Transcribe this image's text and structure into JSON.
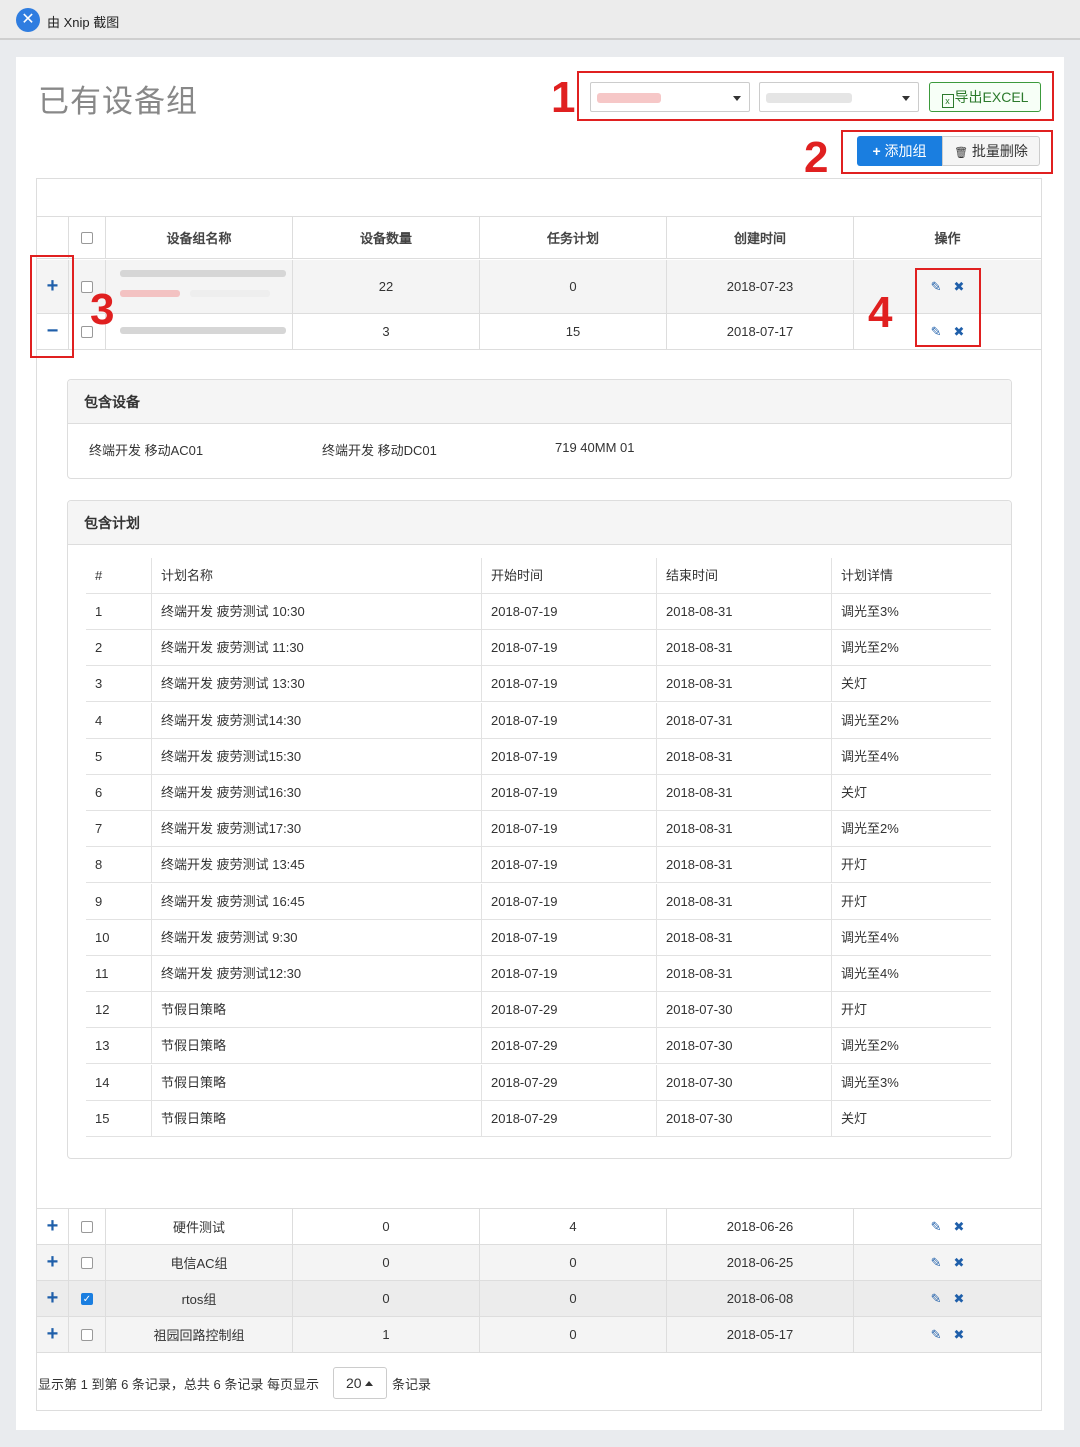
{
  "app": {
    "title": "由 Xnip 截图",
    "logo_glyph": "✕"
  },
  "page": {
    "title": "已有设备组"
  },
  "annotations": [
    "1",
    "2",
    "3",
    "4"
  ],
  "toolbar": {
    "export_label": "导出EXCEL",
    "excel_glyph": "x",
    "add_icon": "+",
    "add_label": "添加组",
    "delete_icon": "🗑",
    "delete_label": "批量删除"
  },
  "colors": {
    "primary": "#1a7ee0",
    "annotation": "#e02020",
    "success": "#3c9a3c",
    "link": "#1f5faa"
  },
  "table": {
    "headers": [
      "设备组名称",
      "设备数量",
      "任务计划",
      "创建时间",
      "操作"
    ],
    "rows": [
      {
        "expander": "+",
        "name": "",
        "count": "22",
        "plans": "0",
        "created": "2018-07-23",
        "checked": false
      },
      {
        "expander": "−",
        "name": "",
        "count": "3",
        "plans": "15",
        "created": "2018-07-17",
        "checked": false
      },
      {
        "expander": "+",
        "name": "硬件测试",
        "count": "0",
        "plans": "4",
        "created": "2018-06-26",
        "checked": false
      },
      {
        "expander": "+",
        "name": "电信AC组",
        "count": "0",
        "plans": "0",
        "created": "2018-06-25",
        "checked": false
      },
      {
        "expander": "+",
        "name": "rtos组",
        "count": "0",
        "plans": "0",
        "created": "2018-06-08",
        "checked": true
      },
      {
        "expander": "+",
        "name": "祖园回路控制组",
        "count": "1",
        "plans": "0",
        "created": "2018-05-17",
        "checked": false
      }
    ],
    "action_icons": {
      "edit": "✎",
      "delete": "✖"
    }
  },
  "devices": {
    "title": "包含设备",
    "items": [
      "终端开发 移动AC01",
      "终端开发 移动DC01",
      "719 40MM 01"
    ]
  },
  "plans": {
    "title": "包含计划",
    "headers": [
      "#",
      "计划名称",
      "开始时间",
      "结束时间",
      "计划详情"
    ],
    "rows": [
      [
        "1",
        "终端开发 疲劳测试 10:30",
        "2018-07-19",
        "2018-08-31",
        "调光至3%"
      ],
      [
        "2",
        "终端开发 疲劳测试 11:30",
        "2018-07-19",
        "2018-08-31",
        "调光至2%"
      ],
      [
        "3",
        "终端开发 疲劳测试 13:30",
        "2018-07-19",
        "2018-08-31",
        "关灯"
      ],
      [
        "4",
        "终端开发 疲劳测试14:30",
        "2018-07-19",
        "2018-07-31",
        "调光至2%"
      ],
      [
        "5",
        "终端开发 疲劳测试15:30",
        "2018-07-19",
        "2018-08-31",
        "调光至4%"
      ],
      [
        "6",
        "终端开发 疲劳测试16:30",
        "2018-07-19",
        "2018-08-31",
        "关灯"
      ],
      [
        "7",
        "终端开发 疲劳测试17:30",
        "2018-07-19",
        "2018-08-31",
        "调光至2%"
      ],
      [
        "8",
        "终端开发 疲劳测试 13:45",
        "2018-07-19",
        "2018-08-31",
        "开灯"
      ],
      [
        "9",
        "终端开发 疲劳测试 16:45",
        "2018-07-19",
        "2018-08-31",
        "开灯"
      ],
      [
        "10",
        "终端开发 疲劳测试 9:30",
        "2018-07-19",
        "2018-08-31",
        "调光至4%"
      ],
      [
        "11",
        "终端开发 疲劳测试12:30",
        "2018-07-19",
        "2018-08-31",
        "调光至4%"
      ],
      [
        "12",
        "节假日策略",
        "2018-07-29",
        "2018-07-30",
        "开灯"
      ],
      [
        "13",
        "节假日策略",
        "2018-07-29",
        "2018-07-30",
        "调光至2%"
      ],
      [
        "14",
        "节假日策略",
        "2018-07-29",
        "2018-07-30",
        "调光至3%"
      ],
      [
        "15",
        "节假日策略",
        "2018-07-29",
        "2018-07-30",
        "关灯"
      ]
    ]
  },
  "pagination": {
    "summary": "显示第 1 到第 6 条记录，总共 6 条记录 每页显示",
    "page_size": "20",
    "suffix": "条记录"
  }
}
